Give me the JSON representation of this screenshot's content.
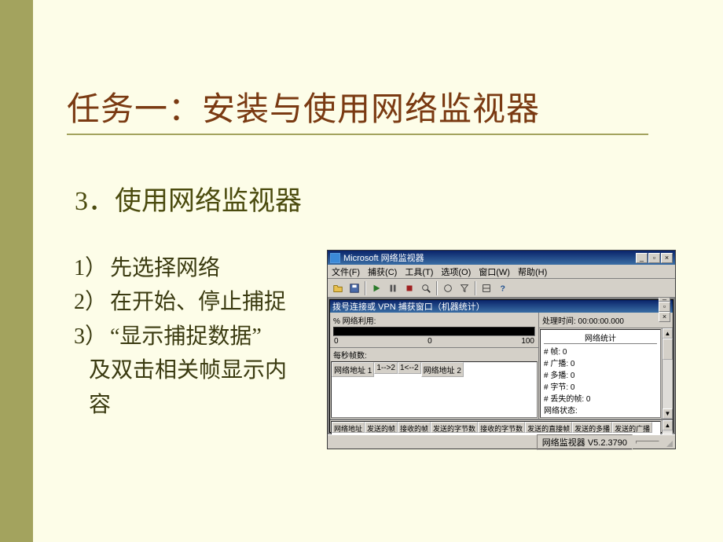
{
  "slide": {
    "title": "任务一：安装与使用网络监视器",
    "subtitle": "3．使用网络监视器",
    "steps": [
      {
        "num": "1）",
        "text": "先选择网络"
      },
      {
        "num": "2）",
        "text": "在开始、停止捕捉"
      },
      {
        "num": "3）",
        "text": "“显示捕捉数据”"
      }
    ],
    "step3_cont": "及双击相关帧显示内",
    "step3_cont2": "容"
  },
  "app": {
    "title": "Microsoft 网络监视器",
    "menu": {
      "file": "文件(F)",
      "capture": "捕获(C)",
      "tools": "工具(T)",
      "options": "选项(O)",
      "window": "窗口(W)",
      "help": "帮助(H)"
    },
    "child_title": "拨号连接或 VPN 捕获窗口（机器统计）",
    "util_label": "% 网络利用:",
    "util_scale": {
      "min": "0",
      "mid": "0",
      "max": "100"
    },
    "fps_label": "每秒帧数:",
    "addr_headers": {
      "a1": "网络地址 1",
      "to12": "1-->2",
      "to21": "1<--2",
      "a2": "网络地址 2"
    },
    "proc_time": "处理时间: 00:00:00.000",
    "stats_title": "网络统计",
    "stats": {
      "frames": "# 帧: 0",
      "broadcast": "# 广播: 0",
      "multicast": "# 多播: 0",
      "bytes": "# 字节: 0",
      "lost": "# 丢失的帧: 0",
      "netstat": "网络状态:"
    },
    "bottom_headers": {
      "c1": "网络地址",
      "c2": "发送的帧",
      "c3": "接收的帧",
      "c4": "发送的字节数",
      "c5": "接收的字节数",
      "c6": "发送的直接帧",
      "c7": "发送的多播",
      "c8": "发送的广播"
    },
    "status": "网络监视器 V5.2.3790",
    "winbtn": {
      "min": "_",
      "max": "▫",
      "close": "×"
    }
  }
}
